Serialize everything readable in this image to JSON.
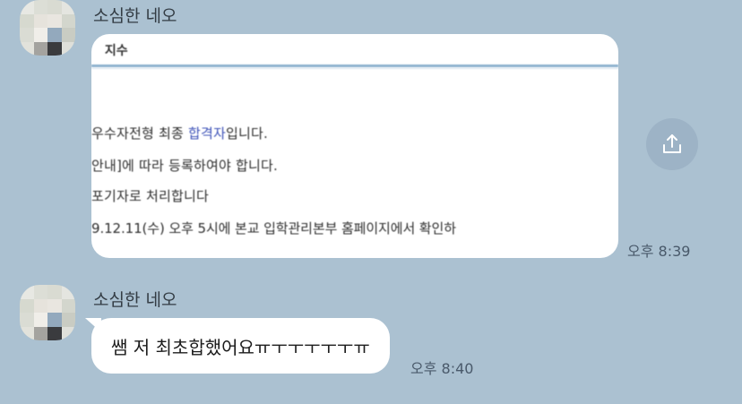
{
  "messages": [
    {
      "sender": "소심한 네오",
      "type": "image",
      "image_text": {
        "header": "ᅟ지수",
        "lines": [
          {
            "pre": "우수자전형 최종 ",
            "highlight": "합격자",
            "post": "입니다."
          },
          {
            "pre": " 안내]에 따라 등록하여야 합니다.",
            "highlight": "",
            "post": ""
          },
          {
            "pre": "포기자로 처리합니다",
            "highlight": "",
            "post": ""
          },
          {
            "pre": "9.12.11(수) 오후 5시에 본교 입학관리본부 홈페이지에서 확인하",
            "highlight": "",
            "post": ""
          }
        ]
      },
      "time": "오후 8:39"
    },
    {
      "sender": "소심한 네오",
      "type": "text",
      "text": "쌤 저 최초합했어요ㅠㅜㅜㅜㅜㅜㅠ",
      "time": "오후 8:40"
    }
  ],
  "share_button": {
    "icon": "share-upload-icon"
  },
  "colors": {
    "background": "#abc1d1",
    "bubble": "#ffffff",
    "highlight": "#3d52b8"
  }
}
